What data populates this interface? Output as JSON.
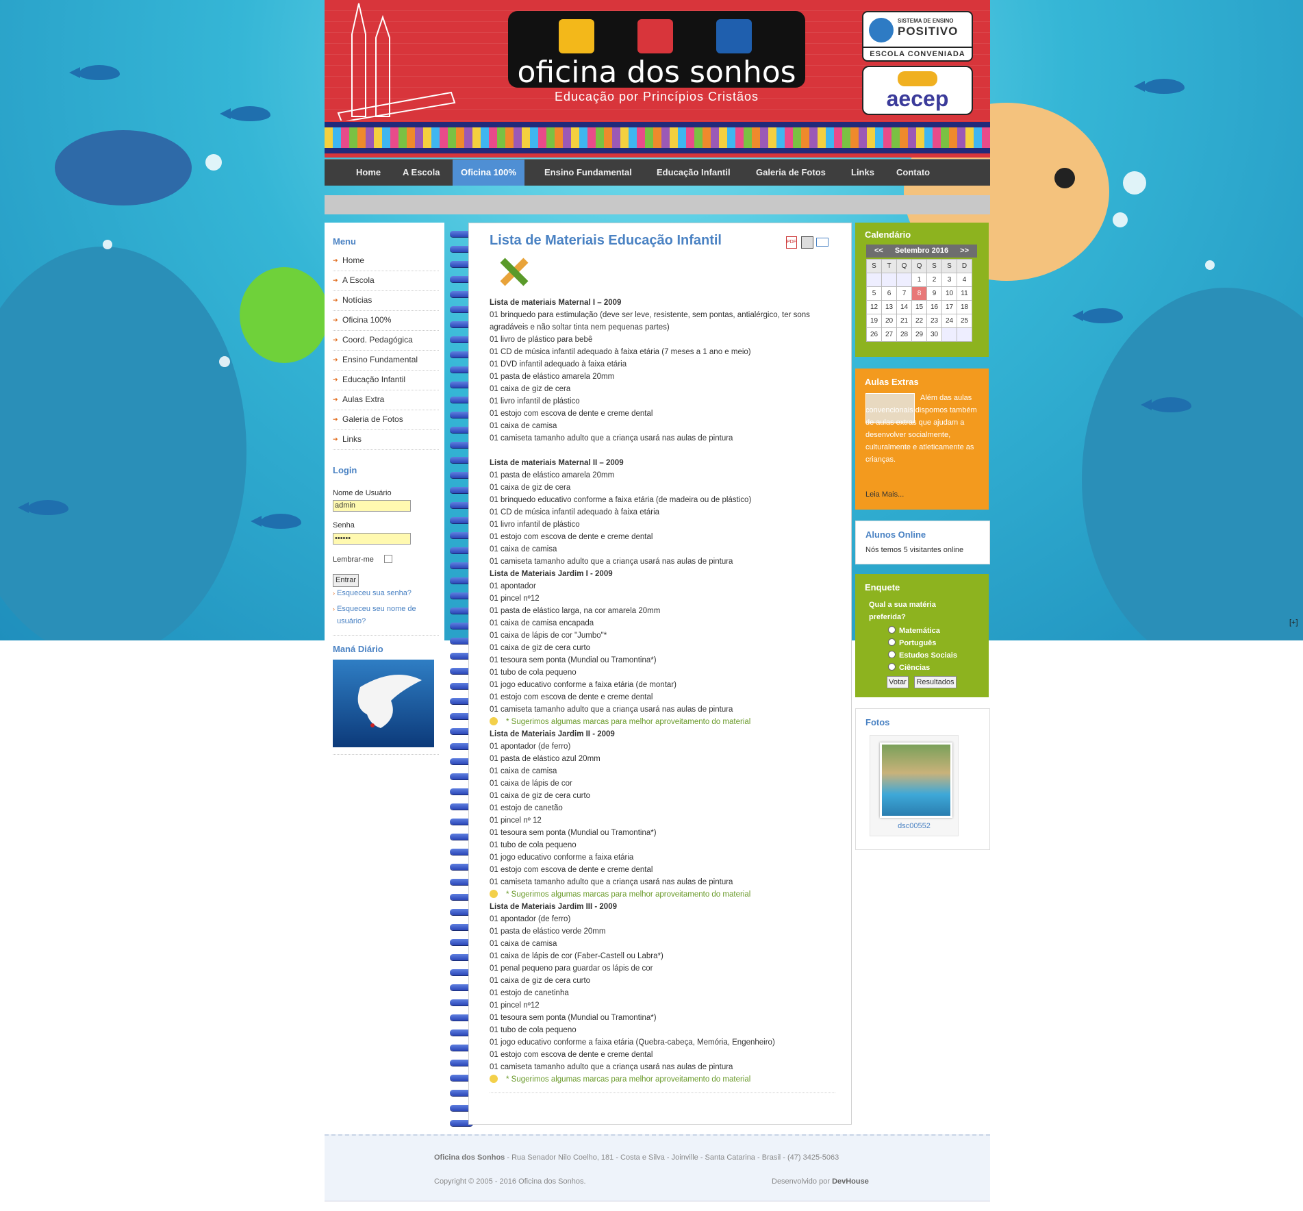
{
  "header": {
    "logo_title": "oficina dos sonhos",
    "logo_tagline": "Educação por Princípios Cristãos",
    "positivo_small": "SISTEMA DE ENSINO",
    "positivo_name": "POSITIVO",
    "positivo_sub": "ESCOLA CONVENIADA",
    "aecep": "aecep"
  },
  "nav": [
    {
      "label": "Home",
      "left": 0
    },
    {
      "label": "A Escola"
    },
    {
      "label": "Oficina 100%"
    },
    {
      "label": "Ensino Fundamental"
    },
    {
      "label": "Educação Infantil"
    },
    {
      "label": "Galeria de Fotos"
    },
    {
      "label": "Links"
    },
    {
      "label": "Contato"
    }
  ],
  "left": {
    "menu_title": "Menu",
    "menu": [
      "Home",
      "A Escola",
      "Notícias",
      "Oficina 100%",
      "Coord. Pedagógica",
      "Ensino Fundamental",
      "Educação Infantil",
      "Aulas Extra",
      "Galeria de Fotos",
      "Links"
    ],
    "login_title": "Login",
    "username_label": "Nome de Usuário",
    "username_value": "admin",
    "password_label": "Senha",
    "password_value": "••••••",
    "remember_label": "Lembrar-me",
    "submit_label": "Entrar",
    "forgot_password": "Esqueceu sua senha?",
    "forgot_username": "Esqueceu seu nome de usuário?",
    "mana_title": "Maná Diário"
  },
  "content": {
    "title": "Lista de Materiais Educação Infantil",
    "lines": [
      {
        "t": "Lista de materiais Maternal I – 2009",
        "s": "b"
      },
      {
        "t": "01 brinquedo para estimulação (deve ser leve, resistente, sem pontas, antialérgico,  ter sons"
      },
      {
        "t": "agradáveis e não soltar tinta nem pequenas partes)"
      },
      {
        "t": "01 livro de plástico para bebê"
      },
      {
        "t": "01 CD de música infantil adequado à faixa etária (7 meses a 1 ano e meio)"
      },
      {
        "t": "01 DVD infantil adequado à faixa etária"
      },
      {
        "t": "01 pasta de elástico amarela 20mm"
      },
      {
        "t": "01 caixa de giz de cera"
      },
      {
        "t": "01 livro infantil de plástico"
      },
      {
        "t": "01 estojo com escova de dente e creme dental"
      },
      {
        "t": "01 caixa de camisa"
      },
      {
        "t": "01 camiseta tamanho adulto que a criança usará nas aulas de pintura"
      },
      {
        "t": ""
      },
      {
        "t": "Lista de materiais Maternal  II – 2009",
        "s": "b"
      },
      {
        "t": "01 pasta de elástico amarela 20mm"
      },
      {
        "t": "01 caixa de giz de cera"
      },
      {
        "t": "01 brinquedo educativo conforme a faixa etária (de madeira ou de plástico)"
      },
      {
        "t": "01 CD de música infantil adequado à faixa etária"
      },
      {
        "t": "01 livro infantil de plástico"
      },
      {
        "t": "01 estojo com escova de dente e creme dental"
      },
      {
        "t": "01 caixa de camisa"
      },
      {
        "t": "01 camiseta tamanho adulto que a criança usará nas aulas de pintura"
      },
      {
        "t": "Lista de Materiais Jardim I - 2009",
        "s": "b"
      },
      {
        "t": "01 apontador"
      },
      {
        "t": "01 pincel nº12"
      },
      {
        "t": "01 pasta de elástico larga, na cor amarela 20mm"
      },
      {
        "t": "01 caixa de camisa encapada"
      },
      {
        "t": "01 caixa de lápis de cor \"Jumbo\"*"
      },
      {
        "t": "01 caixa de giz de cera curto"
      },
      {
        "t": "01 tesoura sem ponta (Mundial ou Tramontina*)"
      },
      {
        "t": "01 tubo de cola pequeno"
      },
      {
        "t": "01 jogo educativo conforme a faixa etária (de montar)"
      },
      {
        "t": "01 estojo com escova de dente e creme dental"
      },
      {
        "t": "01 camiseta tamanho adulto que a criança usará nas aulas de pintura"
      },
      {
        "t": "* Sugerimos algumas marcas para melhor aproveitamento do material",
        "s": "tip"
      },
      {
        "t": "Lista de Materiais Jardim II - 2009",
        "s": "b"
      },
      {
        "t": "01 apontador (de ferro)"
      },
      {
        "t": "01 pasta de elástico azul 20mm"
      },
      {
        "t": "01 caixa de camisa"
      },
      {
        "t": "01 caixa de lápis de cor"
      },
      {
        "t": "01 caixa de giz de cera curto"
      },
      {
        "t": "01 estojo de canetão"
      },
      {
        "t": "01 pincel nº 12"
      },
      {
        "t": "01 tesoura sem ponta (Mundial ou Tramontina*)"
      },
      {
        "t": "01 tubo de cola pequeno"
      },
      {
        "t": "01 jogo educativo conforme a faixa etária"
      },
      {
        "t": "01 estojo com escova de dente e creme dental"
      },
      {
        "t": "01 camiseta tamanho adulto que a criança usará nas aulas de pintura"
      },
      {
        "t": "* Sugerimos algumas marcas para melhor aproveitamento do material",
        "s": "tip"
      },
      {
        "t": "Lista de Materiais Jardim III - 2009",
        "s": "b"
      },
      {
        "t": "01 apontador (de ferro)"
      },
      {
        "t": "01 pasta de elástico verde 20mm"
      },
      {
        "t": "01 caixa de camisa"
      },
      {
        "t": "01 caixa de lápis de cor (Faber-Castell ou Labra*)"
      },
      {
        "t": "01 penal pequeno para guardar os lápis de cor"
      },
      {
        "t": "01 caixa de giz de cera curto"
      },
      {
        "t": "01 estojo de canetinha"
      },
      {
        "t": "01 pincel nº12"
      },
      {
        "t": "01 tesoura sem ponta (Mundial ou Tramontina*)"
      },
      {
        "t": "01 tubo de cola pequeno"
      },
      {
        "t": "01 jogo educativo conforme a faixa etária (Quebra-cabeça, Memória, Engenheiro)"
      },
      {
        "t": "01 estojo com escova de dente e creme dental"
      },
      {
        "t": "01 camiseta tamanho adulto que a criança usará nas aulas de pintura"
      },
      {
        "t": "* Sugerimos algumas marcas para melhor aproveitamento do material",
        "s": "tip"
      }
    ]
  },
  "calendar": {
    "title": "Calendário",
    "month": "Setembro 2016",
    "prev": "<<",
    "next": ">>",
    "weekdays": [
      "S",
      "T",
      "Q",
      "Q",
      "S",
      "S",
      "D"
    ],
    "weeks": [
      [
        "",
        "",
        "",
        "1",
        "2",
        "3",
        "4"
      ],
      [
        "5",
        "6",
        "7",
        "8",
        "9",
        "10",
        "11"
      ],
      [
        "12",
        "13",
        "14",
        "15",
        "16",
        "17",
        "18"
      ],
      [
        "19",
        "20",
        "21",
        "22",
        "23",
        "24",
        "25"
      ],
      [
        "26",
        "27",
        "28",
        "29",
        "30",
        "",
        ""
      ]
    ],
    "today": "8"
  },
  "aulas": {
    "title": "Aulas Extras",
    "text": "Além das aulas convencionais dispomos também de aulas extras que ajudam a desenvolver socialmente, culturalmente e atleticamente as crianças.",
    "more": "Leia Mais..."
  },
  "online": {
    "title": "Alunos Online",
    "text": "Nós temos 5 visitantes online"
  },
  "poll": {
    "title": "Enquete",
    "question": "Qual a sua matéria preferida?",
    "options": [
      "Matemática",
      "Português",
      "Estudos Sociais",
      "Ciências"
    ],
    "vote": "Votar",
    "results": "Resultados"
  },
  "photos": {
    "title": "Fotos",
    "caption": "dsc00552"
  },
  "footer": {
    "name": "Oficina dos Sonhos",
    "address": " - Rua Senador Nilo Coelho, 181 - Costa e Silva - Joinville - Santa Catarina - Brasil - (47) 3425-5063",
    "copyright": "Copyright © 2005 - 2016 Oficina dos Sonhos.",
    "dev_prefix": "Desenvolvido por ",
    "dev_name": "DevHouse"
  },
  "expand": "[+]",
  "colors": {
    "header_red": "#d8353b",
    "nav_active": "#4f8fd4",
    "cal_green": "#8db31f",
    "aulas_orange": "#f39a1e",
    "poll_green": "#8db31f",
    "link_blue": "#4a82c3"
  }
}
